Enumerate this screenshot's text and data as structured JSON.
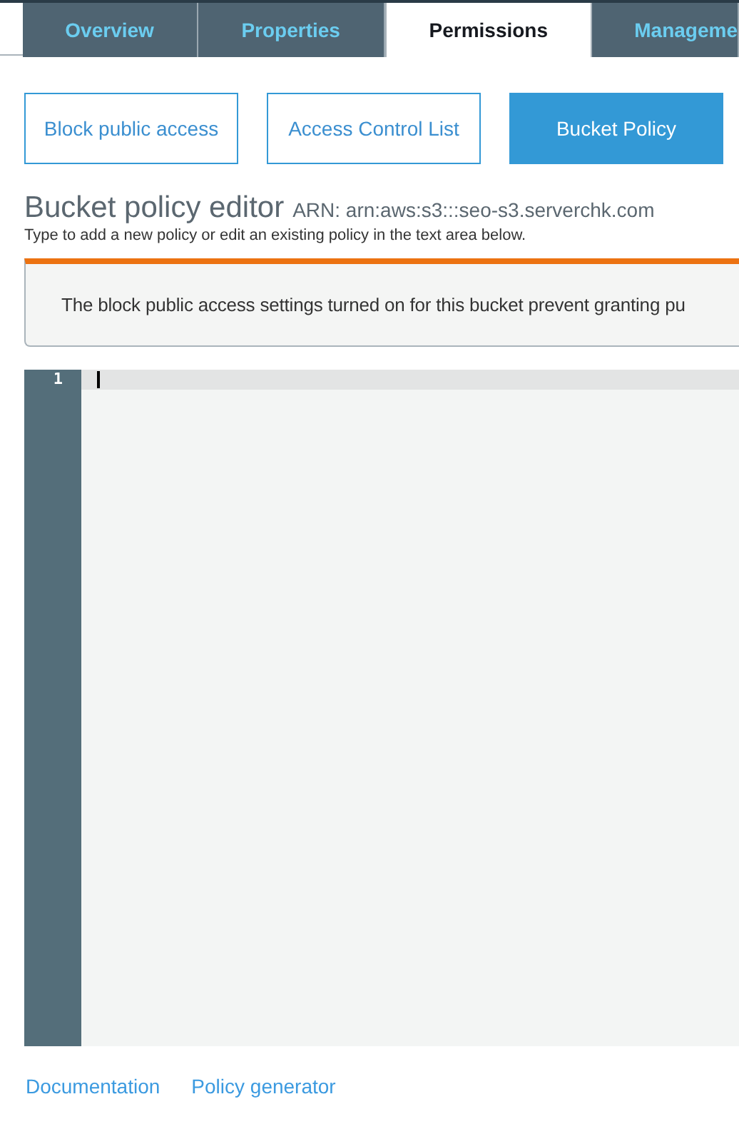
{
  "tabs": [
    {
      "label": "Overview",
      "selected": false
    },
    {
      "label": "Properties",
      "selected": false
    },
    {
      "label": "Permissions",
      "selected": true
    },
    {
      "label": "Manageme",
      "selected": false
    }
  ],
  "sub_tabs": [
    {
      "label": "Block public access",
      "selected": false
    },
    {
      "label": "Access Control List",
      "selected": false
    },
    {
      "label": "Bucket Policy",
      "selected": true
    }
  ],
  "editor_header": {
    "title": "Bucket policy editor",
    "arn": "ARN: arn:aws:s3:::seo-s3.serverchk.com",
    "hint": "Type to add a new policy or edit an existing policy in the text area below."
  },
  "alert": {
    "text": "The block public access settings turned on for this bucket prevent granting pu"
  },
  "editor": {
    "line_numbers": [
      "1"
    ]
  },
  "links": [
    "Documentation",
    "Policy generator"
  ]
}
